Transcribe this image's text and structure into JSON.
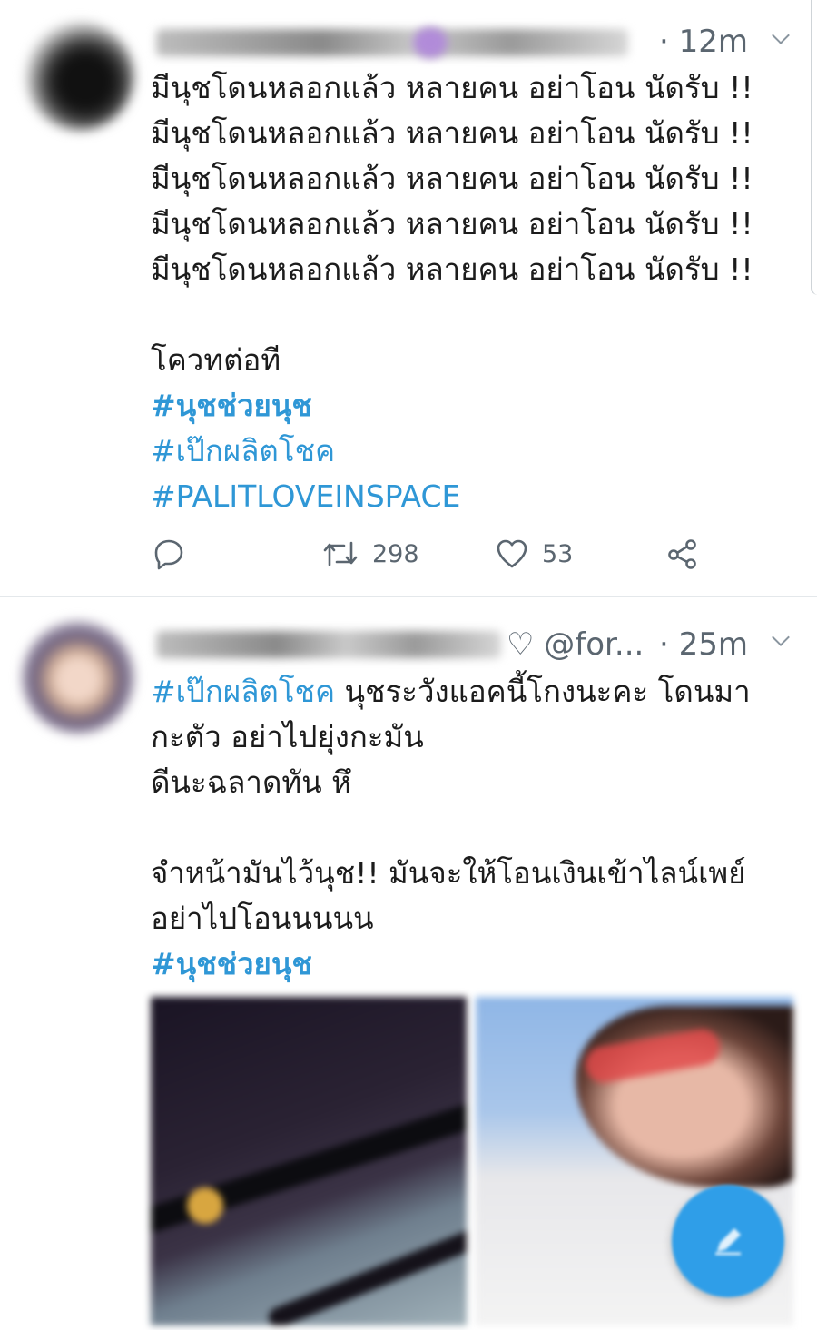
{
  "colors": {
    "hashtag": "#2f97d6",
    "meta_text": "#5b6670",
    "fab": "#2f9ee8"
  },
  "tweets": [
    {
      "timestamp": "· 12m",
      "lines": [
        "มีนุชโดนหลอกแล้ว หลายคน  อย่าโอน นัดรับ !!",
        "มีนุชโดนหลอกแล้ว หลายคน  อย่าโอน นัดรับ !!",
        "มีนุชโดนหลอกแล้ว หลายคน  อย่าโอน นัดรับ !!",
        "มีนุชโดนหลอกแล้ว หลายคน  อย่าโอน นัดรับ !!",
        "มีนุชโดนหลอกแล้ว หลายคน  อย่าโอน นัดรับ !!"
      ],
      "extra_line": "โควทต่อที",
      "hashtags": [
        "#นุชช่วยนุช",
        "#เป๊กผลิตโชค",
        "#PALITLOVEINSPACE"
      ],
      "actions": {
        "reply_icon": "reply-icon",
        "retweet_icon": "retweet-icon",
        "retweet_count": "298",
        "like_icon": "heart-icon",
        "like_count": "53",
        "share_icon": "share-icon"
      }
    },
    {
      "handle": "♡ @for...",
      "timestamp": "· 25m",
      "first_line_tag": "#เป๊กผลิตโชค",
      "first_line_rest": " นุชระวังแอคนี้โกงนะคะ โดนมา",
      "line2": "กะตัว อย่าไปยุ่งกะมัน",
      "line3": "ดีนะฉลาดทัน หึ",
      "line4": "จำหน้ามันไว้นุช!! มันจะให้โอนเงินเข้าไลน์เพย์",
      "line5": "อย่าไปโอนนนนน",
      "hashtag": "#นุชช่วยนุช"
    }
  ],
  "fab_icon": "compose-tweet-icon"
}
